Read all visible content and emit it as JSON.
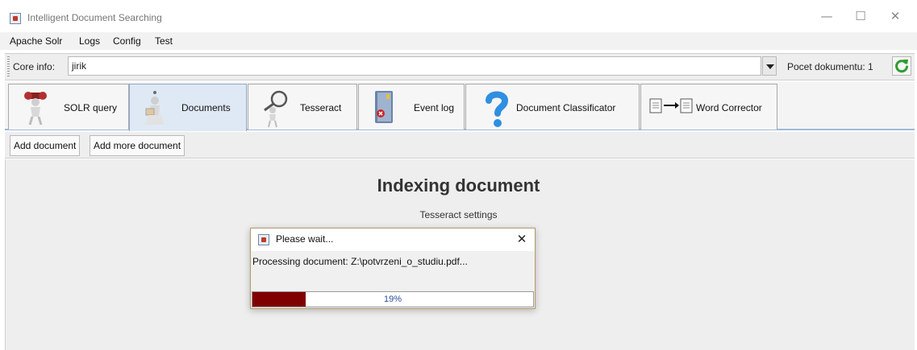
{
  "window": {
    "title": "Intelligent Document Searching",
    "minimize": "—",
    "maximize": "☐",
    "close": "✕"
  },
  "menu": {
    "items": [
      {
        "label": "Apache Solr"
      },
      {
        "label": "Logs"
      },
      {
        "label": "Config"
      },
      {
        "label": "Test"
      }
    ]
  },
  "core": {
    "label": "Core info:",
    "value": "jirik",
    "count_label": "Pocet dokumentu: 1"
  },
  "tabs": [
    {
      "label": "SOLR query",
      "icon": "telescope-figure-icon"
    },
    {
      "label": "Documents",
      "icon": "figure-reading-icon",
      "active": true
    },
    {
      "label": "Tesseract",
      "icon": "magnifier-figure-icon"
    },
    {
      "label": "Event log",
      "icon": "error-book-icon"
    },
    {
      "label": "Document Classificator",
      "icon": "question-mark-icon"
    },
    {
      "label": "Word Corrector",
      "icon": "document-arrow-icon"
    }
  ],
  "toolbar": {
    "add_document": "Add document",
    "add_more_document": "Add more document"
  },
  "content": {
    "title": "Indexing document",
    "subtitle": "Tesseract settings"
  },
  "dialog": {
    "title": "Please wait...",
    "close": "✕",
    "message": "Processing document: Z:\\potvrzeni_o_studiu.pdf...",
    "progress_percent": 19,
    "progress_label": "19%"
  },
  "colors": {
    "progress_fill": "#800000",
    "progress_text": "#2c4f9a",
    "active_tab": "#dfe9f5",
    "refresh_icon": "#2e9e2e"
  }
}
